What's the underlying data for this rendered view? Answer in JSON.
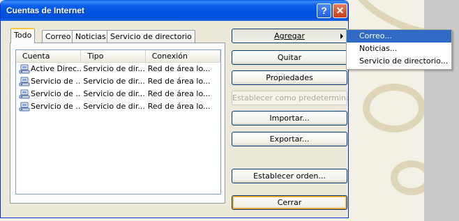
{
  "window": {
    "title": "Cuentas de Internet",
    "help_glyph": "?",
    "close_glyph": "✕"
  },
  "tabs": [
    {
      "label": "Todo",
      "active": true
    },
    {
      "label": "Correo",
      "active": false
    },
    {
      "label": "Noticias",
      "active": false
    },
    {
      "label": "Servicio de directorio",
      "active": false
    }
  ],
  "list": {
    "columns": [
      "Cuenta",
      "Tipo",
      "Conexión"
    ],
    "rows": [
      {
        "account": "Active Direc...",
        "type": "Servicio de dir...",
        "connection": "Red de área lo..."
      },
      {
        "account": "Servicio de ...",
        "type": "Servicio de dir...",
        "connection": "Red de área lo..."
      },
      {
        "account": "Servicio de ...",
        "type": "Servicio de dir...",
        "connection": "Red de área lo..."
      },
      {
        "account": "Servicio de ...",
        "type": "Servicio de dir...",
        "connection": "Red de área lo..."
      }
    ]
  },
  "buttons": {
    "agregar": "Agregar",
    "quitar": "Quitar",
    "propiedades": "Propiedades",
    "predeterminada": "Establecer como predeterminada",
    "importar": "Importar...",
    "exportar": "Exportar...",
    "orden": "Establecer orden...",
    "cerrar": "Cerrar"
  },
  "menu": {
    "items": [
      {
        "label": "Correo...",
        "selected": true
      },
      {
        "label": "Noticias...",
        "selected": false
      },
      {
        "label": "Servicio de directorio...",
        "selected": false
      }
    ]
  },
  "colors": {
    "titlebar": "#0054e3",
    "menu_highlight": "#316ac5",
    "dialog_face": "#ece9d8",
    "focus_ring": "#f8b33a"
  },
  "icons": {
    "account_row": "directory-service-icon",
    "submenu": "submenu-arrow-icon"
  }
}
